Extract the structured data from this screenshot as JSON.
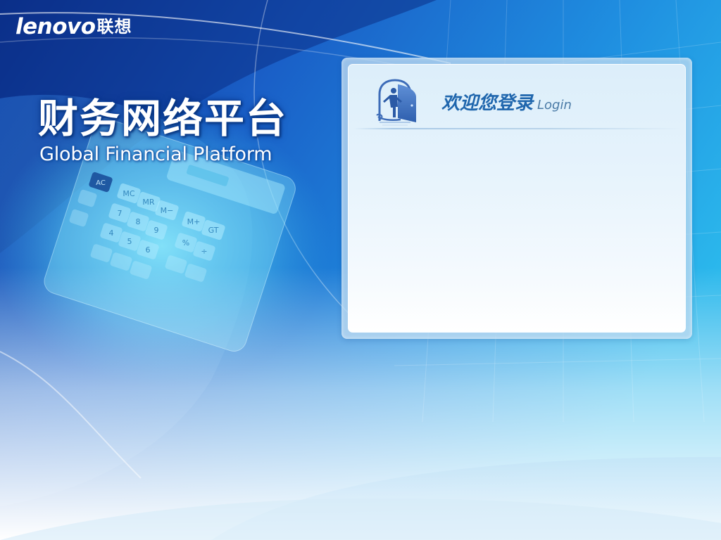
{
  "brand": {
    "latin": "lenovo",
    "cn": "联想"
  },
  "platform": {
    "title_cn": "财务网络平台",
    "title_en": "Global Financial Platform"
  },
  "login": {
    "title": "欢迎您登录",
    "subtitle": "Login"
  },
  "calculator": {
    "keys": [
      "AC",
      "MC",
      "MR",
      "M−",
      "M+",
      "GT",
      "7",
      "8",
      "9",
      "4",
      "5",
      "6",
      "%",
      "÷"
    ]
  },
  "colors": {
    "bg_dark": "#0d3a9a",
    "bg_mid": "#1f7fd4",
    "bg_light": "#2fb6ea",
    "login_title": "#1f66ad",
    "login_sub": "#4a7aa6"
  },
  "icons": {
    "login_icon": "door-person-icon"
  }
}
